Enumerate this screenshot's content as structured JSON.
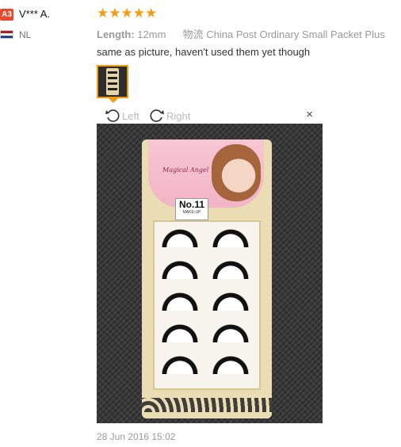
{
  "reviewer": {
    "badge": "A3",
    "name": "V*** A.",
    "country": "NL",
    "flag_colors": [
      "#ae1c28",
      "#ffffff",
      "#21468b"
    ]
  },
  "rating": {
    "stars": "★★★★★",
    "value": 5,
    "max": 5
  },
  "meta": {
    "length_label": "Length:",
    "length_value": "12mm",
    "shipping": "物流 China Post Ordinary Small Packet Plus"
  },
  "comment": "same as picture, haven't used them yet though",
  "viewer": {
    "rotate_left": "Left",
    "rotate_right": "Right",
    "close": "×"
  },
  "product_label": {
    "brand": "Magical Angel",
    "number": "No.11",
    "sub": "MAKE-UP"
  },
  "date": "28 Jun 2016 15:02",
  "colors": {
    "accent": "#f39c12",
    "badge": "#e8492c"
  }
}
